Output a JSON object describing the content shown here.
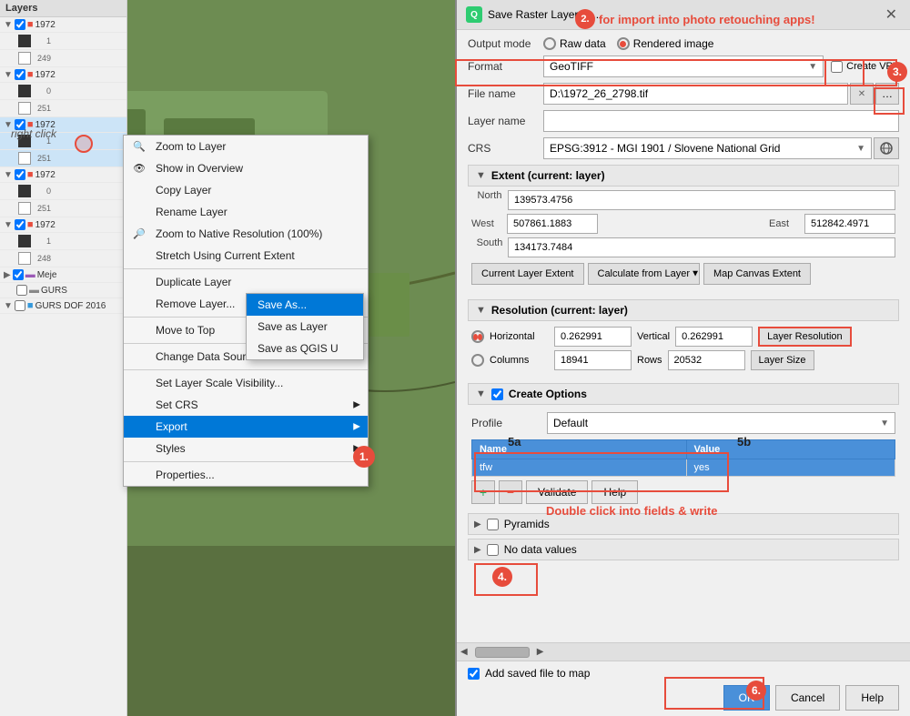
{
  "dialog": {
    "title": "Save Raster Layer as...",
    "close_btn": "✕",
    "subtitle_annotation": "2. for import into photo retouching apps!"
  },
  "output_mode": {
    "label": "Output mode",
    "raw_data": "Raw data",
    "rendered_image": "Rendered image",
    "selected": "rendered_image"
  },
  "format": {
    "label": "Format",
    "value": "GeoTIFF",
    "create_vrt_label": "Create VRT"
  },
  "file_name": {
    "label": "File name",
    "value": "D:\\1972_26_2798.tif"
  },
  "layer_name": {
    "label": "Layer name",
    "value": ""
  },
  "crs": {
    "label": "CRS",
    "value": "EPSG:3912 - MGI 1901 / Slovene National Grid"
  },
  "extent": {
    "header": "Extent (current: layer)",
    "north_label": "North",
    "north_val": "139573.4756",
    "west_label": "West",
    "west_val": "507861.1883",
    "east_label": "East",
    "east_val": "512842.4971",
    "south_label": "South",
    "south_val": "134173.7484",
    "btn_current": "Current Layer Extent",
    "btn_calculate": "Calculate from Layer",
    "btn_map_canvas": "Map Canvas Extent"
  },
  "resolution": {
    "header": "Resolution (current: layer)",
    "horiz_label": "Horizontal",
    "horiz_val": "0.262991",
    "vert_label": "Vertical",
    "vert_val": "0.262991",
    "layer_res_btn": "Layer Resolution",
    "cols_label": "Columns",
    "cols_val": "18941",
    "rows_label": "Rows",
    "rows_val": "20532",
    "layer_size_btn": "Layer Size"
  },
  "create_options": {
    "header": "Create Options",
    "profile_label": "Profile",
    "profile_value": "Default",
    "col_name": "Name",
    "col_value": "Value",
    "rows": [
      {
        "name": "tfw",
        "value": "yes",
        "highlighted": true
      }
    ],
    "instruction": "Double click into fields & write"
  },
  "toolbar": {
    "add_btn": "+",
    "remove_btn": "−",
    "validate_btn": "Validate",
    "help_btn": "Help"
  },
  "pyramids": {
    "label": "Pyramids"
  },
  "no_data": {
    "label": "No data values"
  },
  "footer": {
    "add_to_map_label": "Add saved file to map",
    "ok_btn": "OK",
    "cancel_btn": "Cancel",
    "help_btn": "Help"
  },
  "context_menu": {
    "items": [
      {
        "label": "Zoom to Layer",
        "icon": "🔍",
        "has_arrow": false
      },
      {
        "label": "Show in Overview",
        "icon": "👁",
        "has_arrow": false
      },
      {
        "label": "Copy Layer",
        "icon": "",
        "has_arrow": false
      },
      {
        "label": "Rename Layer",
        "icon": "",
        "has_arrow": false
      },
      {
        "label": "Zoom to Native Resolution (100%)",
        "icon": "🔎",
        "has_arrow": false
      },
      {
        "label": "Stretch Using Current Extent",
        "icon": "",
        "has_arrow": false
      },
      {
        "separator": true
      },
      {
        "label": "Duplicate Layer",
        "icon": "",
        "has_arrow": false
      },
      {
        "label": "Remove Layer...",
        "icon": "",
        "has_arrow": false
      },
      {
        "separator": true
      },
      {
        "label": "Move to Top",
        "icon": "",
        "has_arrow": false
      },
      {
        "separator": true
      },
      {
        "label": "Change Data Source...",
        "icon": "",
        "has_arrow": false
      },
      {
        "separator": true
      },
      {
        "label": "Set Layer Scale Visibility...",
        "icon": "",
        "has_arrow": false
      },
      {
        "label": "Set CRS",
        "icon": "",
        "has_arrow": true
      },
      {
        "label": "Export",
        "icon": "",
        "has_arrow": true,
        "active": true
      },
      {
        "label": "Styles",
        "icon": "",
        "has_arrow": true
      },
      {
        "separator": true
      },
      {
        "label": "Properties...",
        "icon": "",
        "has_arrow": false
      }
    ],
    "submenu": [
      {
        "label": "Save As...",
        "active": true
      },
      {
        "label": "Save as Layer",
        "active": false
      },
      {
        "label": "Save as QGIS U",
        "active": false
      }
    ]
  },
  "annotations": {
    "right_click": "right click",
    "step1": "1.",
    "step2": "2.",
    "step3": "3.",
    "step4": "4.",
    "step5a": "5a",
    "step5b": "5b",
    "step6": "6.",
    "step2_text": "for import into photo retouching apps!",
    "double_click_text": "Double click into fields & write"
  },
  "layers": [
    {
      "name": "1972",
      "num": "1",
      "color": "black"
    },
    {
      "name": "",
      "num": "249",
      "color": "white"
    },
    {
      "name": "1972",
      "num": "0",
      "color": "black"
    },
    {
      "name": "",
      "num": "251",
      "color": "white"
    },
    {
      "name": "1972",
      "num": "1",
      "color": "black",
      "selected": true
    },
    {
      "name": "",
      "num": "251",
      "color": "white"
    },
    {
      "name": "1972",
      "num": "0",
      "color": "black"
    },
    {
      "name": "",
      "num": "251",
      "color": "white"
    },
    {
      "name": "1972",
      "num": "1",
      "color": "black"
    },
    {
      "name": "",
      "num": "248",
      "color": "white"
    },
    {
      "name": "Meje",
      "num": "",
      "color": "purple",
      "checked": true
    },
    {
      "name": "GURS",
      "num": "",
      "color": "gray"
    },
    {
      "name": "GURS DOF 2016",
      "num": "",
      "color": "blue"
    }
  ]
}
